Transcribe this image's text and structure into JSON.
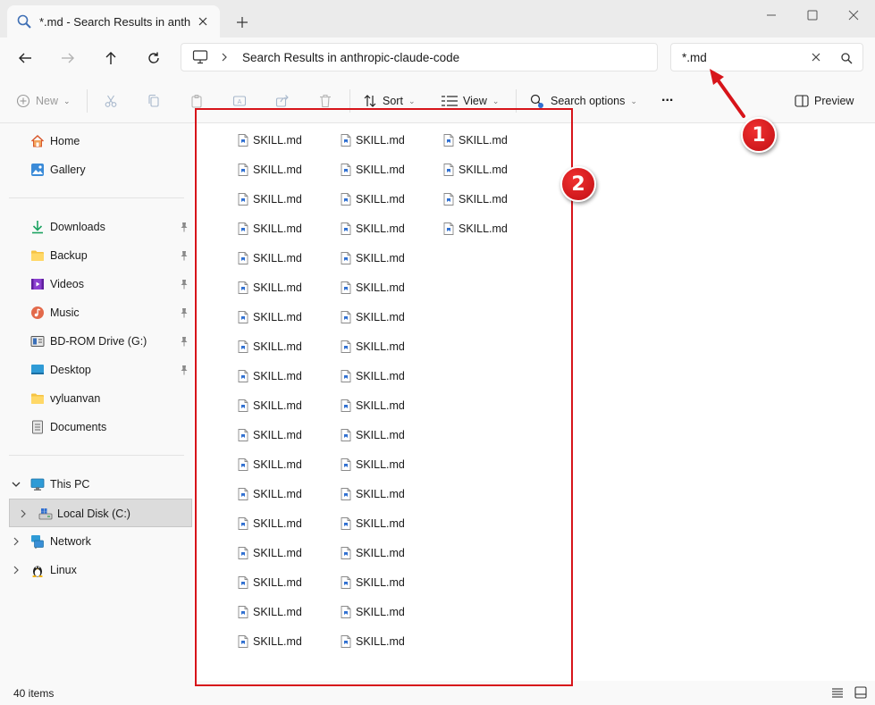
{
  "window": {
    "tab_title": "*.md - Search Results in anthr",
    "new_tab_symbol": "+"
  },
  "address": {
    "breadcrumb": "Search Results in anthropic-claude-code",
    "separator": ">"
  },
  "search": {
    "value": "*.md"
  },
  "toolbar": {
    "new_label": "New",
    "sort_label": "Sort",
    "view_label": "View",
    "search_options_label": "Search options",
    "more_label": "...",
    "preview_label": "Preview"
  },
  "sidebar": {
    "quick": [
      {
        "label": "Home",
        "icon": "home-icon"
      },
      {
        "label": "Gallery",
        "icon": "gallery-icon"
      }
    ],
    "pinned": [
      {
        "label": "Downloads",
        "icon": "downloads-icon"
      },
      {
        "label": "Backup",
        "icon": "folder-icon"
      },
      {
        "label": "Videos",
        "icon": "videos-icon"
      },
      {
        "label": "Music",
        "icon": "music-icon"
      },
      {
        "label": "BD-ROM Drive (G:)",
        "icon": "drive-icon"
      },
      {
        "label": "Desktop",
        "icon": "desktop-icon"
      },
      {
        "label": "vyluanvan",
        "icon": "folder-icon"
      },
      {
        "label": "Documents",
        "icon": "documents-icon"
      }
    ],
    "tree": [
      {
        "label": "This PC",
        "icon": "this-pc-icon",
        "expanded": true
      },
      {
        "label": "Local Disk (C:)",
        "icon": "local-disk-icon",
        "selected": true
      },
      {
        "label": "Network",
        "icon": "network-icon"
      },
      {
        "label": "Linux",
        "icon": "linux-icon"
      }
    ]
  },
  "files": {
    "name": "SKILL.md",
    "columns": [
      18,
      18,
      4
    ]
  },
  "status": {
    "count": "40 items"
  },
  "annotations": {
    "badge1": "1",
    "badge2": "2",
    "color": "#d7141a"
  }
}
